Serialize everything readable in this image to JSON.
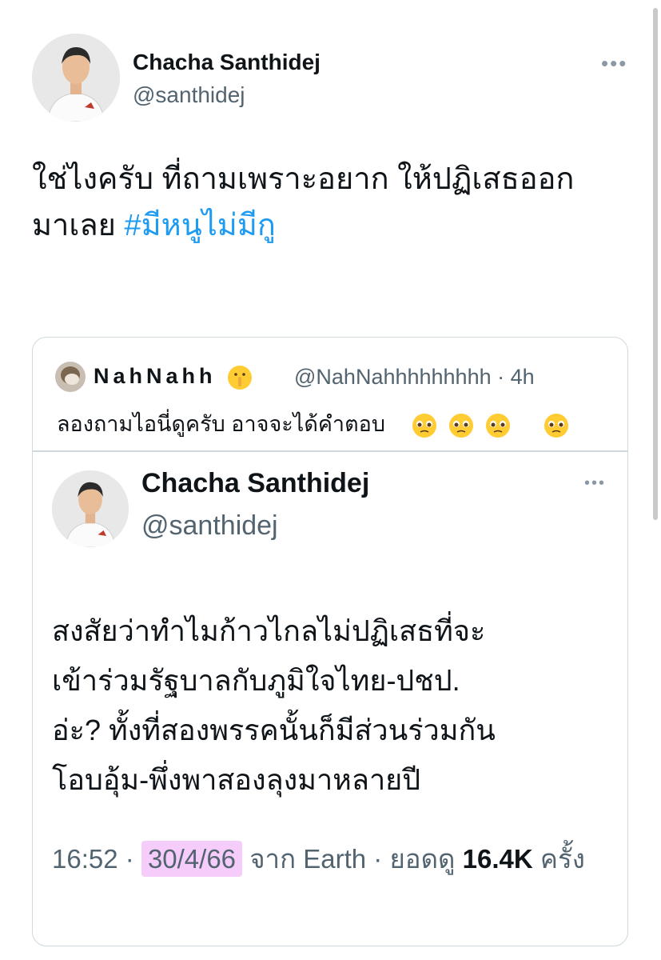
{
  "tweet": {
    "author_name": "Chacha Santhidej",
    "author_handle": "@santhidej",
    "more_icon": "more-dots-icon",
    "text_plain": "ใช่ไงครับ ที่ถามเพราะอยาก ให้ปฏิเสธออก\nมาเลย ",
    "hashtag": "#มีหนูไม่มีกู"
  },
  "quote": {
    "author_name": "NahNahh",
    "author_handle": "@NahNahhhhhhhhh",
    "separator": "·",
    "age": "4h",
    "text": "ลองถามไอนี่ดูครับ อาจจะได้คำตอบ",
    "emojis": [
      "shushing-face-emoji",
      "pleading-face-emoji"
    ]
  },
  "inner_tweet": {
    "author_name": "Chacha Santhidej",
    "author_handle": "@santhidej",
    "text": "สงสัยว่าทำไมก้าวไกลไม่ปฏิเสธที่จะ\nเข้าร่วมรัฐบาลกับภูมิใจไทย-ปชป.\nอ่ะ? ทั้งที่สองพรรคนั้นก็มีส่วนร่วมกัน\nโอบอุ้ม-พึ่งพาสองลุงมาหลายปี",
    "time": "16:52",
    "sep": "·",
    "date": "30/4/66",
    "source": "จาก Earth",
    "views_label": "ยอดดู",
    "views_count": "16.4K",
    "views_unit": "ครั้ง"
  },
  "colors": {
    "link": "#1d9bf0",
    "secondary_text": "#536471",
    "border": "#cfd9de",
    "highlight": "#f6cdfa"
  }
}
